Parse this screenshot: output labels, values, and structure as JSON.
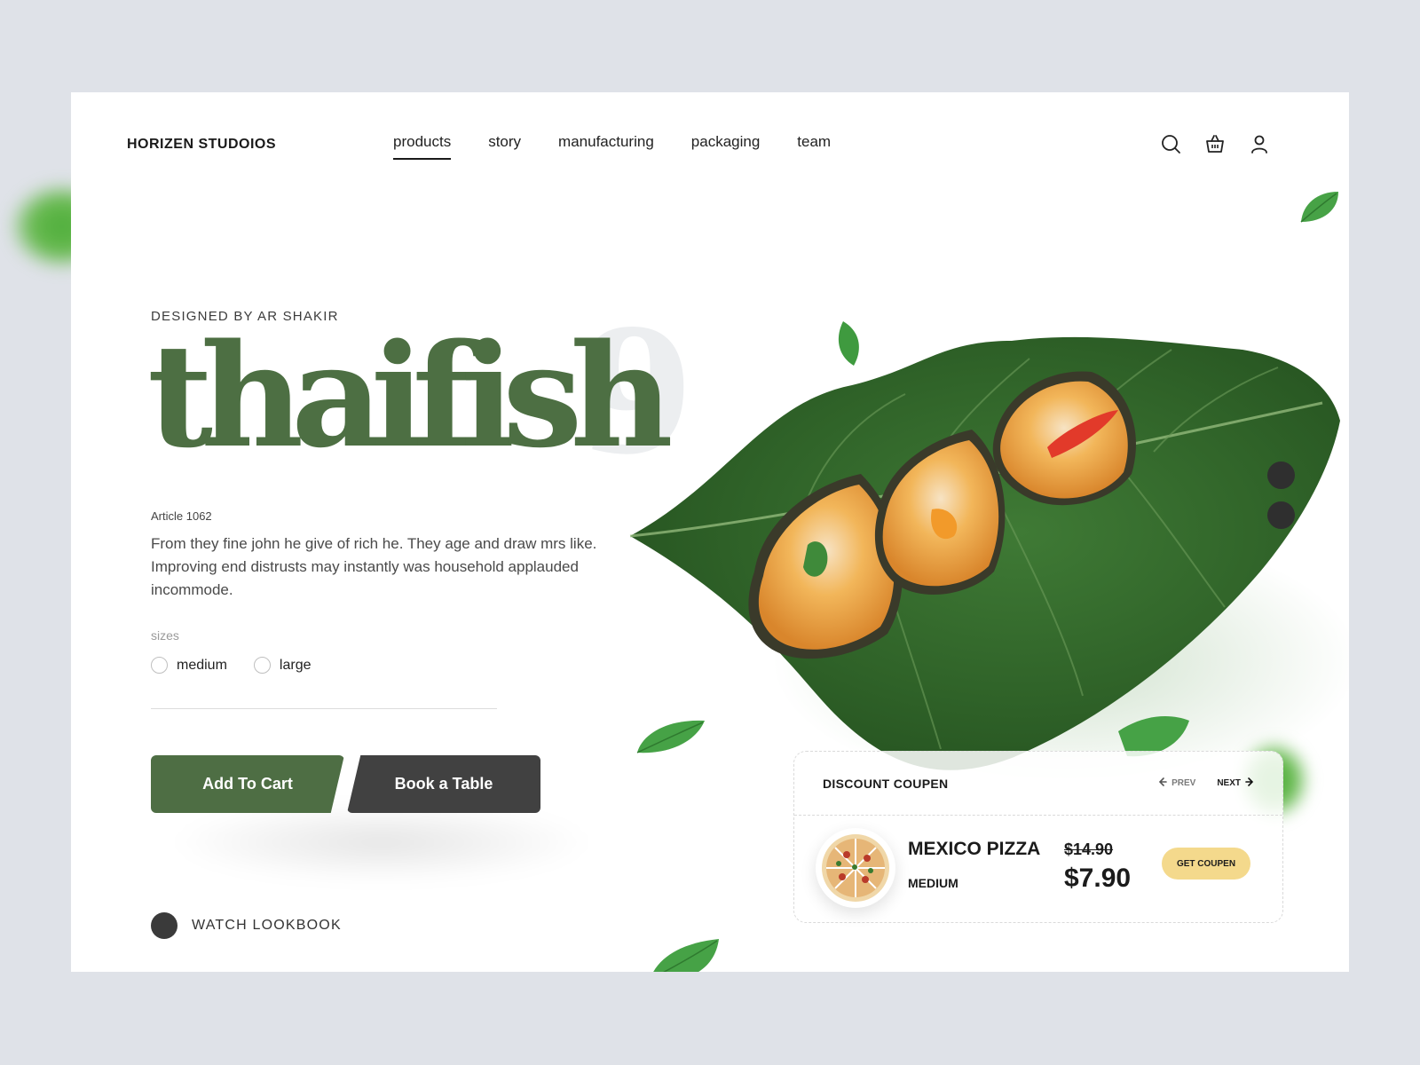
{
  "brand": "HORIZEN STUDOIOS",
  "nav": {
    "items": [
      "products",
      "story",
      "manufacturing",
      "packaging",
      "team"
    ],
    "active": "products"
  },
  "icons": [
    "search-icon",
    "basket-icon",
    "user-icon"
  ],
  "hero": {
    "eyebrow": "DESIGNED BY AR SHAKIR",
    "title": "thaifish",
    "number": "9",
    "article": "Article 1062",
    "description": "From they fine john he give of rich he. They age and draw mrs like. Improving end distrusts may instantly was household applauded incommode."
  },
  "sizes": {
    "label": "sizes",
    "options": [
      "medium",
      "large"
    ]
  },
  "buttons": {
    "add_to_cart": "Add To Cart",
    "book_table": "Book a Table"
  },
  "lookbook": "WATCH LOOKBOOK",
  "coupon": {
    "title": "DISCOUNT COUPEN",
    "prev": "PREV",
    "next": "NEXT",
    "item_name": "MEXICO PIZZA",
    "item_size": "MEDIUM",
    "old_price": "$14.90",
    "new_price": "$7.90",
    "cta": "GET COUPEN"
  },
  "colors": {
    "accent_green": "#4d6f43",
    "dark_button": "#414141",
    "coupon_button": "#f4d98c",
    "page_bg": "#dfe2e8"
  }
}
